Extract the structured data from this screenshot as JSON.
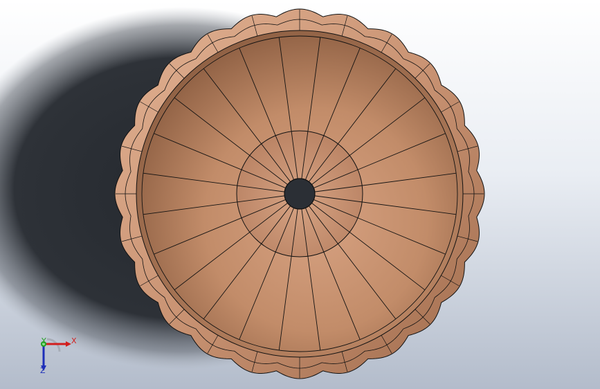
{
  "app": {
    "view": "graphics-viewport",
    "model_name": "",
    "render_mode": "shaded-with-edges"
  },
  "colors": {
    "background_top": "#ffffff",
    "background_bottom": "#b3bccb",
    "shadow": "#25292f",
    "body_light": "#d9a582",
    "body_mid": "#c08a67",
    "body_dark": "#8f6043",
    "edge": "#111111",
    "hole": "#2b2f35",
    "axis_x": "#d21e1e",
    "axis_y": "#22a022",
    "axis_z": "#1e2fb9"
  },
  "model": {
    "radial_segments": 24,
    "rim_lobes": 24,
    "icon": "bowl-part-icon"
  },
  "triad": {
    "x_label": "X",
    "y_label": "Y",
    "z_label": "Z"
  }
}
